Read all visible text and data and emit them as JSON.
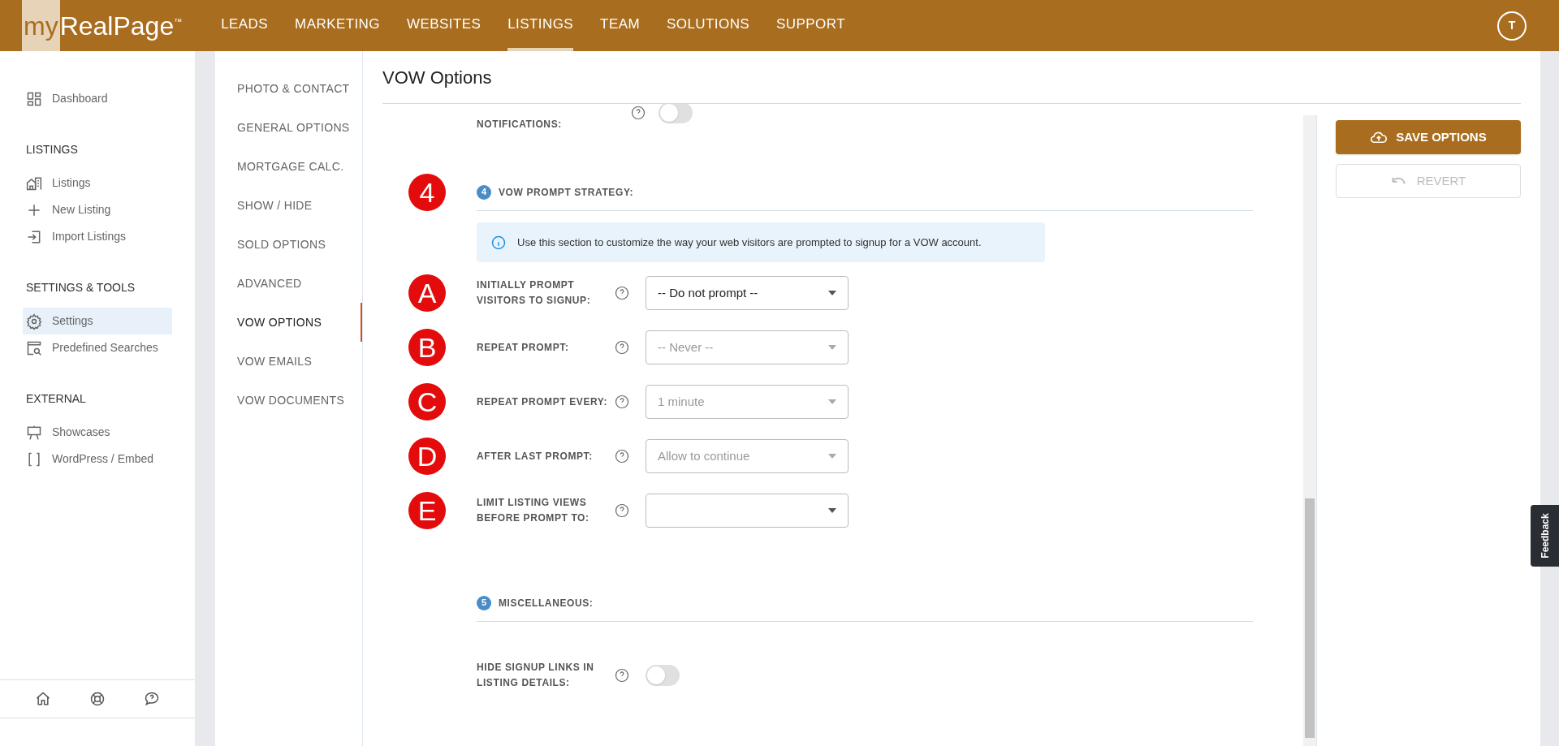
{
  "header": {
    "logo": {
      "prefix": "my",
      "name": "RealPage",
      "mark": "™"
    },
    "nav": [
      {
        "label": "LEADS",
        "selected": false
      },
      {
        "label": "MARKETING",
        "selected": false
      },
      {
        "label": "WEBSITES",
        "selected": false
      },
      {
        "label": "LISTINGS",
        "selected": true
      },
      {
        "label": "TEAM",
        "selected": false
      },
      {
        "label": "SOLUTIONS",
        "selected": false
      },
      {
        "label": "SUPPORT",
        "selected": false
      }
    ],
    "avatar": "T"
  },
  "sidebar": {
    "sections": [
      {
        "items": [
          {
            "label": "Dashboard",
            "kind": "dashboard",
            "selected": false
          }
        ]
      },
      {
        "title": "LISTINGS",
        "items": [
          {
            "label": "Listings",
            "kind": "buildings",
            "selected": false
          },
          {
            "label": "New Listing",
            "kind": "plus",
            "selected": false
          },
          {
            "label": "Import Listings",
            "kind": "import",
            "selected": false
          }
        ]
      },
      {
        "title": "SETTINGS & TOOLS",
        "items": [
          {
            "label": "Settings",
            "kind": "gear",
            "selected": true
          },
          {
            "label": "Predefined Searches",
            "kind": "search-list",
            "selected": false
          }
        ]
      },
      {
        "title": "EXTERNAL",
        "items": [
          {
            "label": "Showcases",
            "kind": "easel",
            "selected": false
          },
          {
            "label": "WordPress / Embed",
            "kind": "brackets",
            "selected": false
          }
        ]
      }
    ]
  },
  "subnav": [
    {
      "label": "PHOTO & CONTACT",
      "selected": false
    },
    {
      "label": "GENERAL OPTIONS",
      "selected": false
    },
    {
      "label": "MORTGAGE CALC.",
      "selected": false
    },
    {
      "label": "SHOW / HIDE",
      "selected": false
    },
    {
      "label": "SOLD OPTIONS",
      "selected": false
    },
    {
      "label": "ADVANCED",
      "selected": false
    },
    {
      "label": "VOW OPTIONS",
      "selected": true
    },
    {
      "label": "VOW EMAILS",
      "selected": false
    },
    {
      "label": "VOW DOCUMENTS",
      "selected": false
    }
  ],
  "page_title": "VOW Options",
  "top_row": {
    "label": "NOTIFICATIONS:",
    "on": false
  },
  "sections": [
    {
      "number": "4",
      "marker": "4",
      "title": "VOW PROMPT STRATEGY:",
      "info": "Use this section to customize the way your web visitors are prompted to signup for a VOW account.",
      "rows": [
        {
          "kind": "select",
          "marker": "A",
          "label": "INITIALLY PROMPT VISITORS TO SIGNUP:",
          "value": "-- Do not prompt --",
          "disabled": false
        },
        {
          "kind": "select",
          "marker": "B",
          "label": "REPEAT PROMPT:",
          "value": "-- Never --",
          "disabled": true
        },
        {
          "kind": "select",
          "marker": "C",
          "label": "REPEAT PROMPT EVERY:",
          "value": "1 minute",
          "disabled": true
        },
        {
          "kind": "select",
          "marker": "D",
          "label": "AFTER LAST PROMPT:",
          "value": "Allow to continue",
          "disabled": true
        },
        {
          "kind": "select",
          "marker": "E",
          "label": "LIMIT LISTING VIEWS BEFORE PROMPT TO:",
          "disabled": false
        }
      ]
    },
    {
      "number": "5",
      "title": "MISCELLANEOUS:",
      "rows": [
        {
          "kind": "toggle",
          "label": "HIDE SIGNUP LINKS IN LISTING DETAILS:",
          "on": false
        }
      ]
    }
  ],
  "actions": {
    "save": {
      "label": "SAVE OPTIONS",
      "disabled": false
    },
    "revert": {
      "label": "REVERT",
      "disabled": true
    }
  },
  "feedback": "Feedback"
}
